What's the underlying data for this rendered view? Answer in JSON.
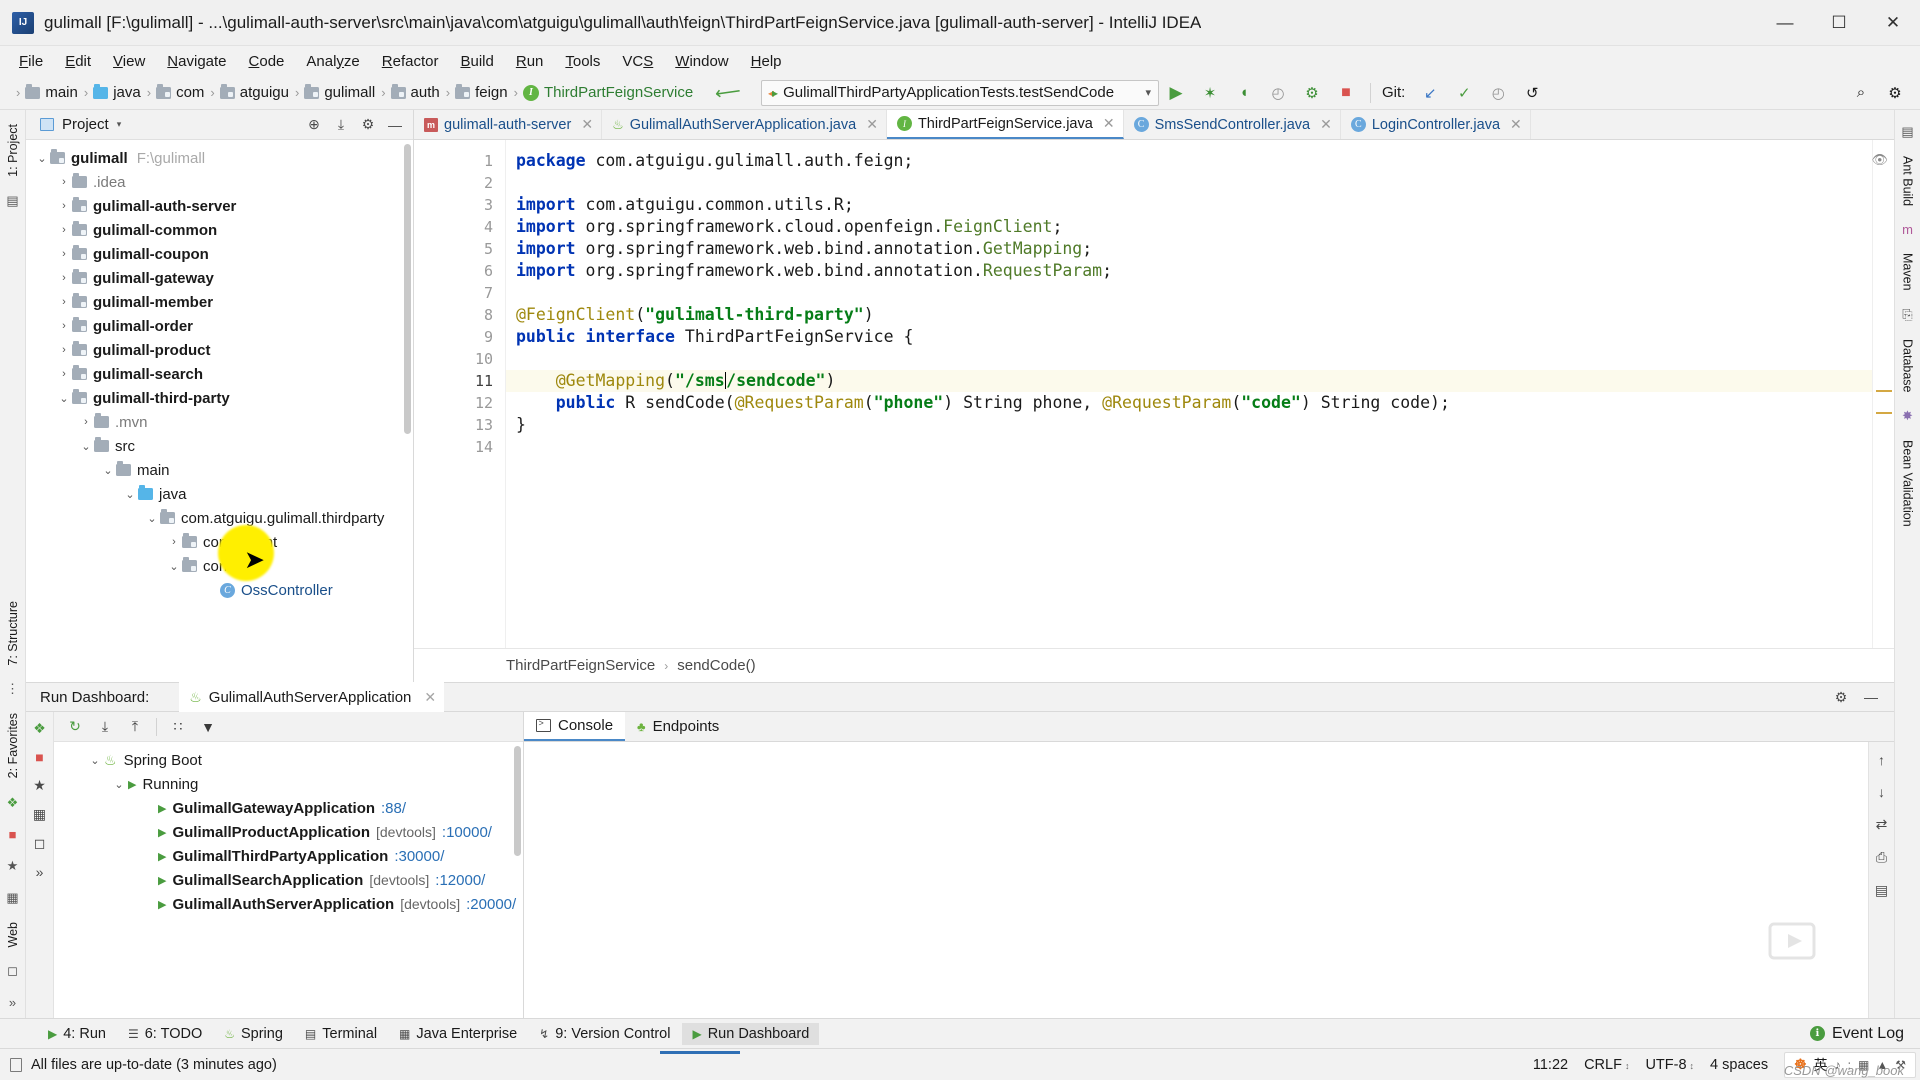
{
  "window": {
    "title": "gulimall [F:\\gulimall] - ...\\gulimall-auth-server\\src\\main\\java\\com\\atguigu\\gulimall\\auth\\feign\\ThirdPartFeignService.java [gulimall-auth-server] - IntelliJ IDEA",
    "minimize": "—",
    "maximize": "☐",
    "close": "✕"
  },
  "menubar": {
    "items": [
      "File",
      "Edit",
      "View",
      "Navigate",
      "Code",
      "Analyze",
      "Refactor",
      "Build",
      "Run",
      "Tools",
      "VCS",
      "Window",
      "Help"
    ]
  },
  "navbar": {
    "breadcrumbs": [
      {
        "label": "main",
        "icon": "folder-icon",
        "kind": "folder"
      },
      {
        "label": "java",
        "icon": "source-folder-icon",
        "kind": "source"
      },
      {
        "label": "com",
        "icon": "package-icon",
        "kind": "package"
      },
      {
        "label": "atguigu",
        "icon": "package-icon",
        "kind": "package"
      },
      {
        "label": "gulimall",
        "icon": "package-icon",
        "kind": "package"
      },
      {
        "label": "auth",
        "icon": "package-icon",
        "kind": "package"
      },
      {
        "label": "feign",
        "icon": "package-icon",
        "kind": "package"
      },
      {
        "label": "ThirdPartFeignService",
        "icon": "interface-icon",
        "kind": "interface"
      }
    ],
    "make_project": "build-hammer-icon",
    "run_config": {
      "name": "GulimallThirdPartyApplicationTests.testSendCode",
      "dropdown": "▾"
    },
    "actions": [
      {
        "name": "run-button",
        "glyph": "▶"
      },
      {
        "name": "debug-button",
        "glyph": "✶"
      },
      {
        "name": "run-with-coverage-button",
        "glyph": "◖"
      },
      {
        "name": "profiler-button",
        "glyph": "◴"
      },
      {
        "name": "attach-debugger-button",
        "glyph": "⚙"
      },
      {
        "name": "stop-button",
        "glyph": "■"
      }
    ],
    "git_label": "Git:",
    "git_actions": [
      {
        "name": "update-project-icon",
        "glyph": "↙"
      },
      {
        "name": "commit-icon",
        "glyph": "✓"
      },
      {
        "name": "history-icon",
        "glyph": "◴"
      },
      {
        "name": "rollback-icon",
        "glyph": "↺"
      }
    ],
    "right_actions": [
      {
        "name": "search-everywhere-icon",
        "glyph": "⌕"
      },
      {
        "name": "settings-icon",
        "glyph": "⚙"
      }
    ]
  },
  "left_strip": {
    "tabs": [
      {
        "label": "1: Project",
        "name": "tool-window-project"
      },
      {
        "label": "7: Structure",
        "name": "tool-window-structure"
      },
      {
        "label": "2: Favorites",
        "name": "tool-window-favorites"
      },
      {
        "label": "Web",
        "name": "tool-window-web"
      }
    ],
    "icons": [
      "camera-icon",
      "chevrons-icon"
    ]
  },
  "right_strip": {
    "tabs": [
      {
        "label": "Ant Build",
        "name": "tool-window-ant-build"
      },
      {
        "label": "Maven",
        "name": "tool-window-maven"
      },
      {
        "label": "Database",
        "name": "tool-window-database"
      },
      {
        "label": "Bean Validation",
        "name": "tool-window-bean-validation"
      }
    ]
  },
  "project_panel": {
    "title": "Project",
    "caret": "▾",
    "actions": [
      {
        "name": "locate-icon",
        "glyph": "⊕"
      },
      {
        "name": "collapse-all-icon",
        "glyph": "⤓"
      },
      {
        "name": "settings-icon",
        "glyph": "⚙"
      },
      {
        "name": "hide-icon",
        "glyph": "—"
      }
    ],
    "tree": [
      {
        "depth": 0,
        "arrow": "⌄",
        "icon": "module-icon",
        "label": "gulimall",
        "bold": true,
        "sub": "F:\\gulimall"
      },
      {
        "depth": 1,
        "arrow": "›",
        "icon": "folder-icon",
        "label": ".idea",
        "bold": false,
        "gray": true
      },
      {
        "depth": 1,
        "arrow": "›",
        "icon": "module-icon",
        "label": "gulimall-auth-server",
        "bold": true
      },
      {
        "depth": 1,
        "arrow": "›",
        "icon": "module-icon",
        "label": "gulimall-common",
        "bold": true
      },
      {
        "depth": 1,
        "arrow": "›",
        "icon": "module-icon",
        "label": "gulimall-coupon",
        "bold": true
      },
      {
        "depth": 1,
        "arrow": "›",
        "icon": "module-icon",
        "label": "gulimall-gateway",
        "bold": true
      },
      {
        "depth": 1,
        "arrow": "›",
        "icon": "module-icon",
        "label": "gulimall-member",
        "bold": true
      },
      {
        "depth": 1,
        "arrow": "›",
        "icon": "module-icon",
        "label": "gulimall-order",
        "bold": true
      },
      {
        "depth": 1,
        "arrow": "›",
        "icon": "module-icon",
        "label": "gulimall-product",
        "bold": true
      },
      {
        "depth": 1,
        "arrow": "›",
        "icon": "module-icon",
        "label": "gulimall-search",
        "bold": true
      },
      {
        "depth": 1,
        "arrow": "⌄",
        "icon": "module-icon",
        "label": "gulimall-third-party",
        "bold": true
      },
      {
        "depth": 2,
        "arrow": "›",
        "icon": "folder-icon",
        "label": ".mvn",
        "bold": false,
        "gray": true
      },
      {
        "depth": 2,
        "arrow": "⌄",
        "icon": "folder-icon",
        "label": "src",
        "bold": false
      },
      {
        "depth": 3,
        "arrow": "⌄",
        "icon": "folder-icon",
        "label": "main",
        "bold": false
      },
      {
        "depth": 4,
        "arrow": "⌄",
        "icon": "source-folder-icon",
        "label": "java",
        "bold": false
      },
      {
        "depth": 5,
        "arrow": "⌄",
        "icon": "package-icon",
        "label": "com.atguigu.gulimall.thirdparty",
        "bold": false
      },
      {
        "depth": 6,
        "arrow": "›",
        "icon": "package-icon",
        "label": "component",
        "bold": false
      },
      {
        "depth": 6,
        "arrow": "⌄",
        "icon": "package-icon",
        "label": "controller",
        "bold": false
      },
      {
        "depth": 7,
        "arrow": "",
        "icon": "class-icon",
        "label": "OssController",
        "bold": false
      }
    ]
  },
  "editor": {
    "tabs": [
      {
        "label": "gulimall-auth-server",
        "icon": "maven-icon",
        "close": "✕",
        "active": false
      },
      {
        "label": "GulimallAuthServerApplication.java",
        "icon": "spring-class-icon",
        "close": "✕",
        "active": false
      },
      {
        "label": "ThirdPartFeignService.java",
        "icon": "interface-icon",
        "close": "✕",
        "active": true
      },
      {
        "label": "SmsSendController.java",
        "icon": "class-icon",
        "close": "✕",
        "active": false
      },
      {
        "label": "LoginController.java",
        "icon": "class-icon",
        "close": "✕",
        "active": false
      }
    ],
    "line_numbers": [
      "1",
      "2",
      "3",
      "4",
      "5",
      "6",
      "7",
      "8",
      "9",
      "10",
      "11",
      "12",
      "13",
      "14"
    ],
    "current_line": 11,
    "code_lines": [
      "package com.atguigu.gulimall.auth.feign;",
      "",
      "import com.atguigu.common.utils.R;",
      "import org.springframework.cloud.openfeign.FeignClient;",
      "import org.springframework.web.bind.annotation.GetMapping;",
      "import org.springframework.web.bind.annotation.RequestParam;",
      "",
      "@FeignClient(\"gulimall-third-party\")",
      "public interface ThirdPartFeignService {",
      "",
      "    @GetMapping(\"/sms/sendcode\")",
      "    public R sendCode(@RequestParam(\"phone\") String phone, @RequestParam(\"code\") String code);",
      "}",
      ""
    ],
    "breadcrumb": [
      "ThirdPartFeignService",
      "sendCode()"
    ],
    "breadcrumb_sep": "›"
  },
  "run_dashboard": {
    "label": "Run Dashboard:",
    "tab": {
      "label": "GulimallAuthServerApplication",
      "icon": "spring-boot-running-icon",
      "close": "✕"
    },
    "header_actions": [
      {
        "name": "settings-icon",
        "glyph": "⚙"
      },
      {
        "name": "hide-icon",
        "glyph": "—"
      }
    ],
    "toolbar": [
      {
        "name": "rerun-icon",
        "glyph": "↻"
      },
      {
        "name": "expand-all-icon",
        "glyph": "⤓"
      },
      {
        "name": "collapse-all-icon",
        "glyph": "⤒"
      },
      {
        "name": "group-by-icon",
        "glyph": "∷"
      },
      {
        "name": "filter-icon",
        "glyph": "▼"
      }
    ],
    "side_icons": [
      "puzzle-icon",
      "stop-icon",
      "star-icon",
      "layout-icon",
      "camera-icon",
      "chevrons-icon"
    ],
    "tree": [
      {
        "depth": 0,
        "arrow": "⌄",
        "icon": "spring-icon",
        "label": "Spring Boot",
        "bold": false
      },
      {
        "depth": 1,
        "arrow": "⌄",
        "icon": "run-icon",
        "label": "Running",
        "bold": false
      },
      {
        "depth": 2,
        "arrow": "",
        "icon": "run-icon",
        "label": "GulimallGatewayApplication",
        "devtools": "",
        "port": ":88/"
      },
      {
        "depth": 2,
        "arrow": "",
        "icon": "run-icon",
        "label": "GulimallProductApplication",
        "devtools": "[devtools]",
        "port": ":10000/"
      },
      {
        "depth": 2,
        "arrow": "",
        "icon": "run-icon",
        "label": "GulimallThirdPartyApplication",
        "devtools": "",
        "port": ":30000/"
      },
      {
        "depth": 2,
        "arrow": "",
        "icon": "run-icon",
        "label": "GulimallSearchApplication",
        "devtools": "[devtools]",
        "port": ":12000/"
      },
      {
        "depth": 2,
        "arrow": "",
        "icon": "run-icon",
        "label": "GulimallAuthServerApplication",
        "devtools": "[devtools]",
        "port": ":20000/"
      }
    ],
    "console_tabs": [
      {
        "label": "Console",
        "icon": "console-icon",
        "active": true
      },
      {
        "label": "Endpoints",
        "icon": "endpoints-icon",
        "active": false
      }
    ],
    "console_side_icons": [
      "scroll-up-icon",
      "scroll-down-icon",
      "soft-wrap-icon",
      "print-icon"
    ]
  },
  "bottom_toolbar": {
    "items": [
      {
        "label": "4: Run",
        "underline": "4",
        "icon": "run-icon",
        "active": false
      },
      {
        "label": "6: TODO",
        "underline": "6",
        "icon": "todo-icon",
        "active": false
      },
      {
        "label": "Spring",
        "underline": "",
        "icon": "spring-icon",
        "active": false
      },
      {
        "label": "Terminal",
        "underline": "",
        "icon": "terminal-icon",
        "active": false
      },
      {
        "label": "Java Enterprise",
        "underline": "",
        "icon": "java-enterprise-icon",
        "active": false
      },
      {
        "label": "9: Version Control",
        "underline": "9",
        "icon": "vcs-icon",
        "active": false
      },
      {
        "label": "Run Dashboard",
        "underline": "",
        "icon": "run-dashboard-icon",
        "active": true
      }
    ],
    "event_log": {
      "label": "Event Log",
      "icon": "event-log-icon"
    }
  },
  "statusbar": {
    "message": "All files are up-to-date (3 minutes ago)",
    "position": "11:22",
    "line_separator": "CRLF",
    "encoding": "UTF-8",
    "indent": "4 spaces",
    "caret": "↕",
    "ime": {
      "logo": "☸",
      "lang": "英",
      "tone": "♪",
      "punct": ":",
      "panel": "▦",
      "user": "▲",
      "tools": "⚒"
    }
  },
  "watermark": "CSDN @wang_book"
}
